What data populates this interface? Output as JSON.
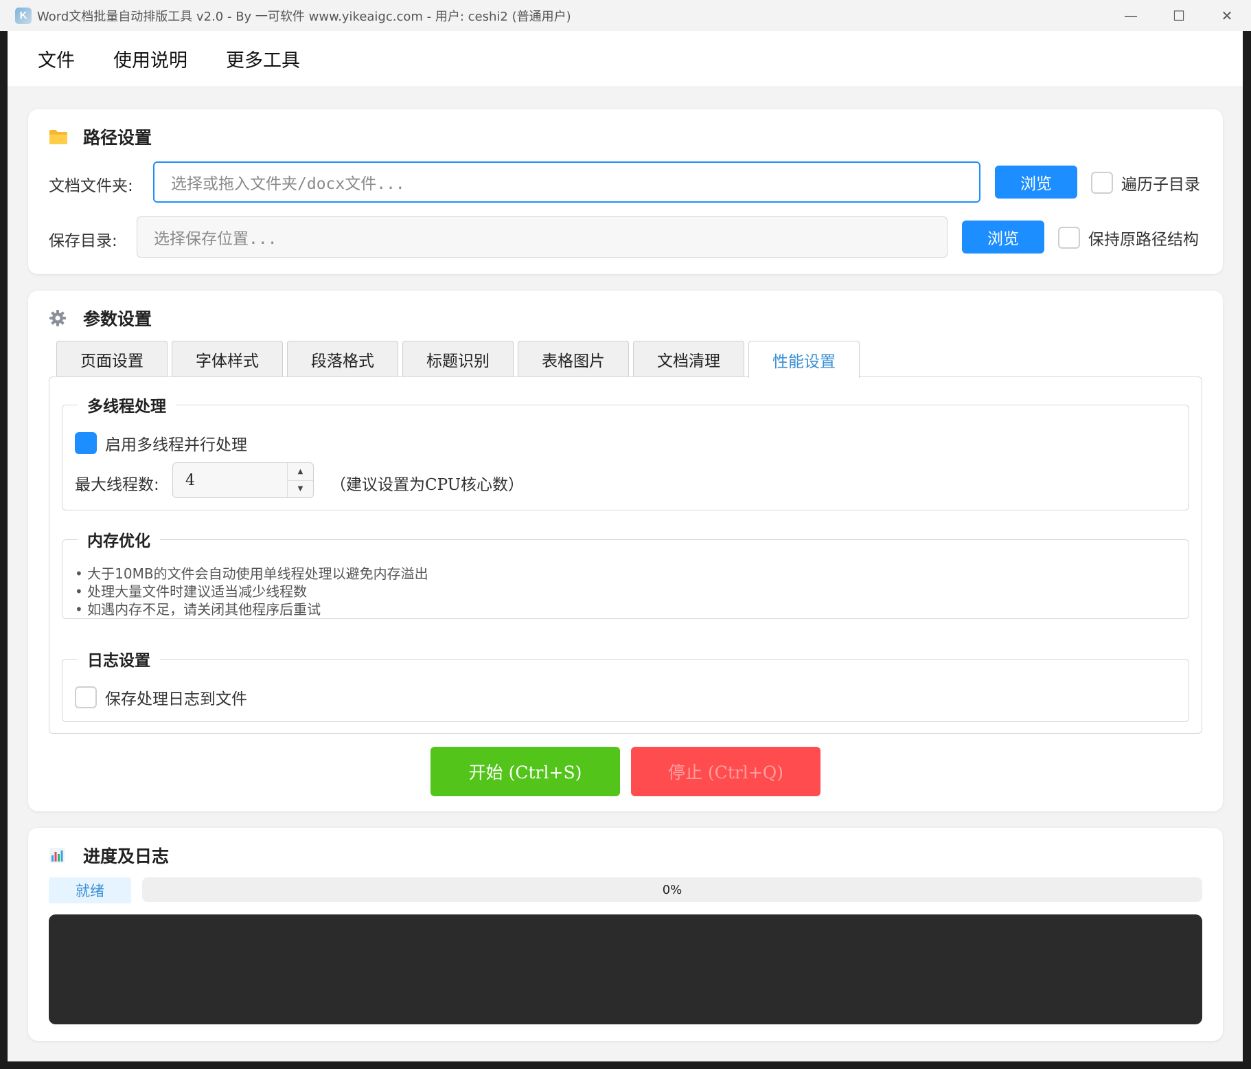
{
  "window": {
    "title": "Word文档批量自动排版工具 v2.0 - By 一可软件 www.yikeaigc.com - 用户: ceshi2 (普通用户)",
    "icon_text": "K",
    "controls": {
      "minimize": "—",
      "maximize": "☐",
      "close": "✕"
    }
  },
  "menu": {
    "items": [
      {
        "label": "文件"
      },
      {
        "label": "使用说明"
      },
      {
        "label": "更多工具"
      }
    ]
  },
  "path_settings": {
    "title": "路径设置",
    "icon": "folder-icon",
    "doc_folder": {
      "label": "文档文件夹:",
      "placeholder": "选择或拖入文件夹/docx文件...",
      "browse": "浏览",
      "option": "遍历子目录",
      "option_checked": false
    },
    "save_dir": {
      "label": "保存目录:",
      "placeholder": "选择保存位置...",
      "browse": "浏览",
      "option": "保持原路径结构",
      "option_checked": false
    }
  },
  "params": {
    "title": "参数设置",
    "icon": "gear-icon",
    "tabs": [
      {
        "label": "页面设置"
      },
      {
        "label": "字体样式"
      },
      {
        "label": "段落格式"
      },
      {
        "label": "标题识别"
      },
      {
        "label": "表格图片"
      },
      {
        "label": "文档清理"
      },
      {
        "label": "性能设置"
      }
    ],
    "active_tab": 6,
    "multithread": {
      "title": "多线程处理",
      "enable_label": "启用多线程并行处理",
      "enable_checked": true,
      "max_threads_label": "最大线程数:",
      "max_threads_value": "4",
      "hint": "（建议设置为CPU核心数）"
    },
    "memory": {
      "title": "内存优化",
      "lines": [
        "• 大于10MB的文件会自动使用单线程处理以避免内存溢出",
        "• 处理大量文件时建议适当减少线程数",
        "• 如遇内存不足，请关闭其他程序后重试"
      ]
    },
    "log": {
      "title": "日志设置",
      "save_label": "保存处理日志到文件",
      "save_checked": false
    },
    "start_label": "开始 (Ctrl+S)",
    "stop_label": "停止 (Ctrl+Q)"
  },
  "progress": {
    "title": "进度及日志",
    "icon": "bar-chart-icon",
    "status": "就绪",
    "percent_text": "0%",
    "percent": 0
  },
  "colors": {
    "accent": "#1c8eff",
    "start": "#52c41a",
    "stop": "#ff4d4f",
    "log_bg": "#2b2b2b"
  }
}
